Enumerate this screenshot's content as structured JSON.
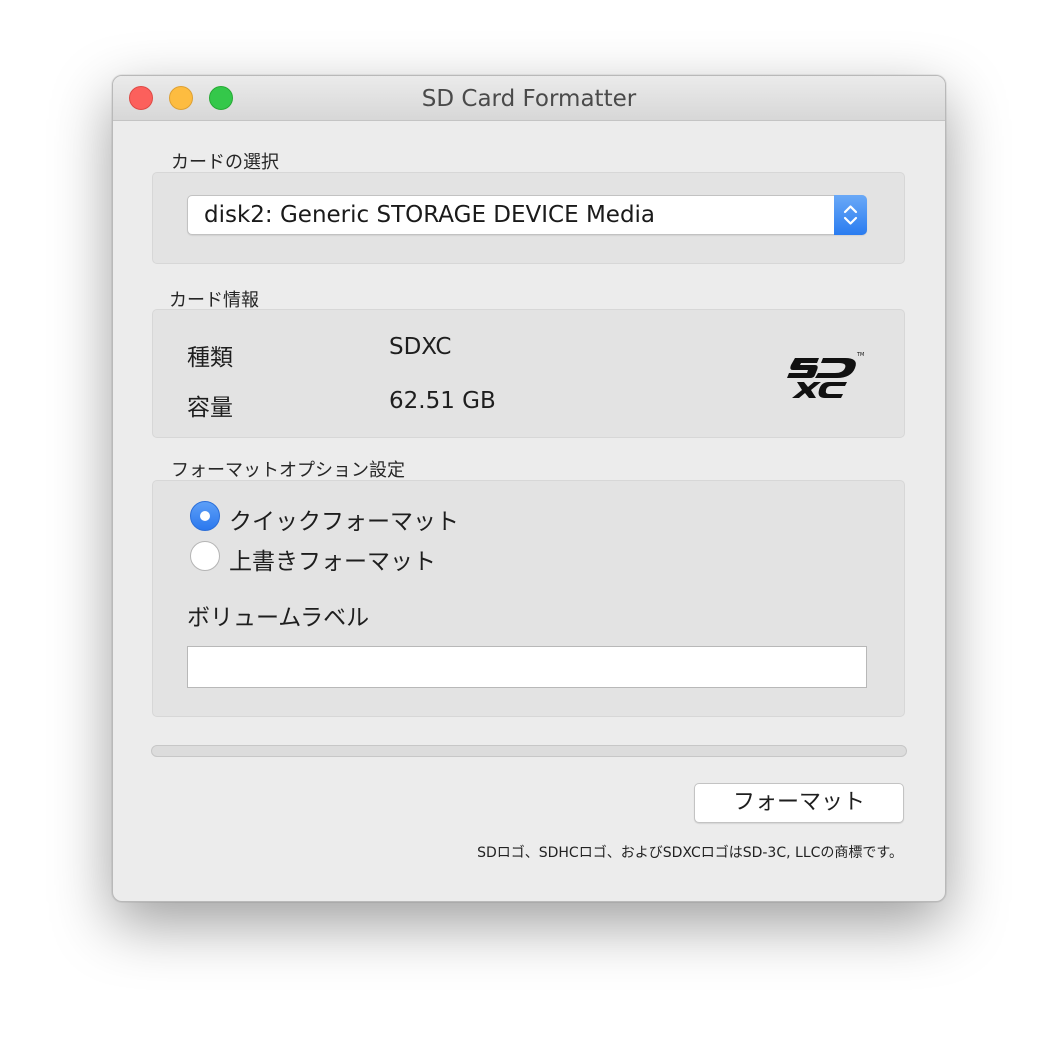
{
  "window": {
    "title": "SD Card Formatter"
  },
  "card_select": {
    "label": "カードの選択",
    "selected": "disk2: Generic STORAGE DEVICE Media"
  },
  "card_info": {
    "label": "カード情報",
    "type_label": "種類",
    "type_value": "SDXC",
    "capacity_label": "容量",
    "capacity_value": "62.51 GB",
    "logo_icon": "sdxc-logo-icon"
  },
  "format_options": {
    "label": "フォーマットオプション設定",
    "quick_format_label": "クイックフォーマット",
    "overwrite_format_label": "上書きフォーマット",
    "selected_option": "quick",
    "volume_label_title": "ボリュームラベル",
    "volume_label_value": ""
  },
  "progress": {
    "value": 0
  },
  "actions": {
    "format_button_label": "フォーマット"
  },
  "footer": {
    "trademark_text": "SDロゴ、SDHCロゴ、およびSDXCロゴはSD-3C, LLCの商標です。"
  },
  "colors": {
    "accent": "#2b78ee",
    "window_bg": "#ececec",
    "close": "#fc605c",
    "minimize": "#fdbc40",
    "maximize": "#34c84a"
  }
}
